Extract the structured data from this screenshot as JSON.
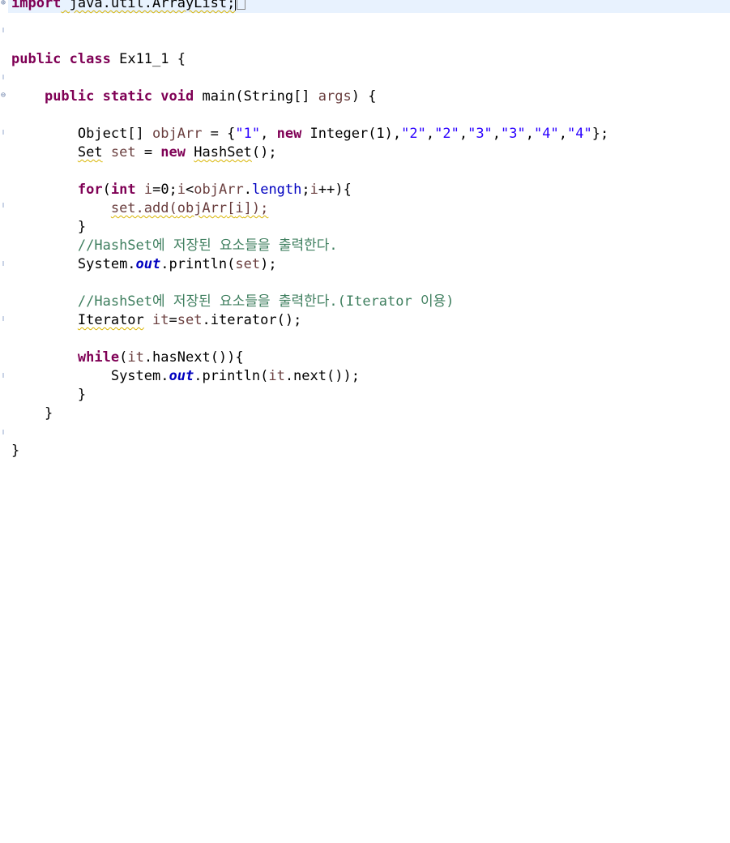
{
  "editor": {
    "lines": {
      "l1": {
        "kw": "import",
        "text": " java.util.ArrayList;"
      },
      "l3": {
        "kw1": "public",
        "kw2": "class",
        "name": " Ex11_1 {"
      },
      "l5": {
        "kw1": "public",
        "kw2": "static",
        "kw3": "void",
        "sig": " main(String[] ",
        "param": "args",
        "end": ") {"
      },
      "l7": {
        "a": "Object[] ",
        "var": "objArr",
        "b": " = {",
        "s1": "\"1\"",
        "c": ", ",
        "kw": "new",
        "d": " Integer(1),",
        "s2": "\"2\"",
        "e": ",",
        "s3": "\"2\"",
        "f": ",",
        "s4": "\"3\"",
        "g": ",",
        "s5": "\"3\"",
        "h": ",",
        "s6": "\"4\"",
        "i": ",",
        "s7": "\"4\"",
        "j": "};"
      },
      "l8": {
        "type": "Set",
        "sp": " ",
        "var": "set",
        "b": " = ",
        "kw": "new",
        "c": " ",
        "type2": "HashSet",
        "d": "();"
      },
      "l10": {
        "kw1": "for",
        "a": "(",
        "kw2": "int",
        "b": " ",
        "v1": "i",
        "c": "=0;",
        "v2": "i",
        "d": "<",
        "v3": "objArr",
        "e": ".",
        "fld": "length",
        "f": ";",
        "v4": "i",
        "g": "++){"
      },
      "l11": {
        "call": "set.add(",
        "v": "objArr",
        "a": "[",
        "v2": "i",
        "b": "]);"
      },
      "l12": {
        "text": "}"
      },
      "l13": {
        "comment": "//HashSet에 저장된 요소들을 출력한다."
      },
      "l14": {
        "a": "System.",
        "fld": "out",
        "b": ".println(",
        "v": "set",
        "c": ");"
      },
      "l16": {
        "comment": "//HashSet에 저장된 요소들을 출력한다.(Iterator 이용)"
      },
      "l17": {
        "type": "Iterator",
        "a": " ",
        "v": "it",
        "b": "=",
        "v2": "set",
        "c": ".iterator();"
      },
      "l19": {
        "kw": "while",
        "a": "(",
        "v": "it",
        "b": ".hasNext()){"
      },
      "l20": {
        "a": "System.",
        "fld": "out",
        "b": ".println(",
        "v": "it",
        "c": ".next());"
      },
      "l21": {
        "text": "}"
      },
      "l22": {
        "text": "}"
      },
      "l24": {
        "text": "}"
      }
    },
    "colors": {
      "keyword": "#7f0055",
      "string": "#2a00ff",
      "comment": "#3f7f5f",
      "field": "#0000c0",
      "local": "#6a3e3e",
      "current_line": "#e8f2fe"
    },
    "icons": [
      "fold-expanded-icon",
      "fold-collapsed-icon"
    ]
  }
}
